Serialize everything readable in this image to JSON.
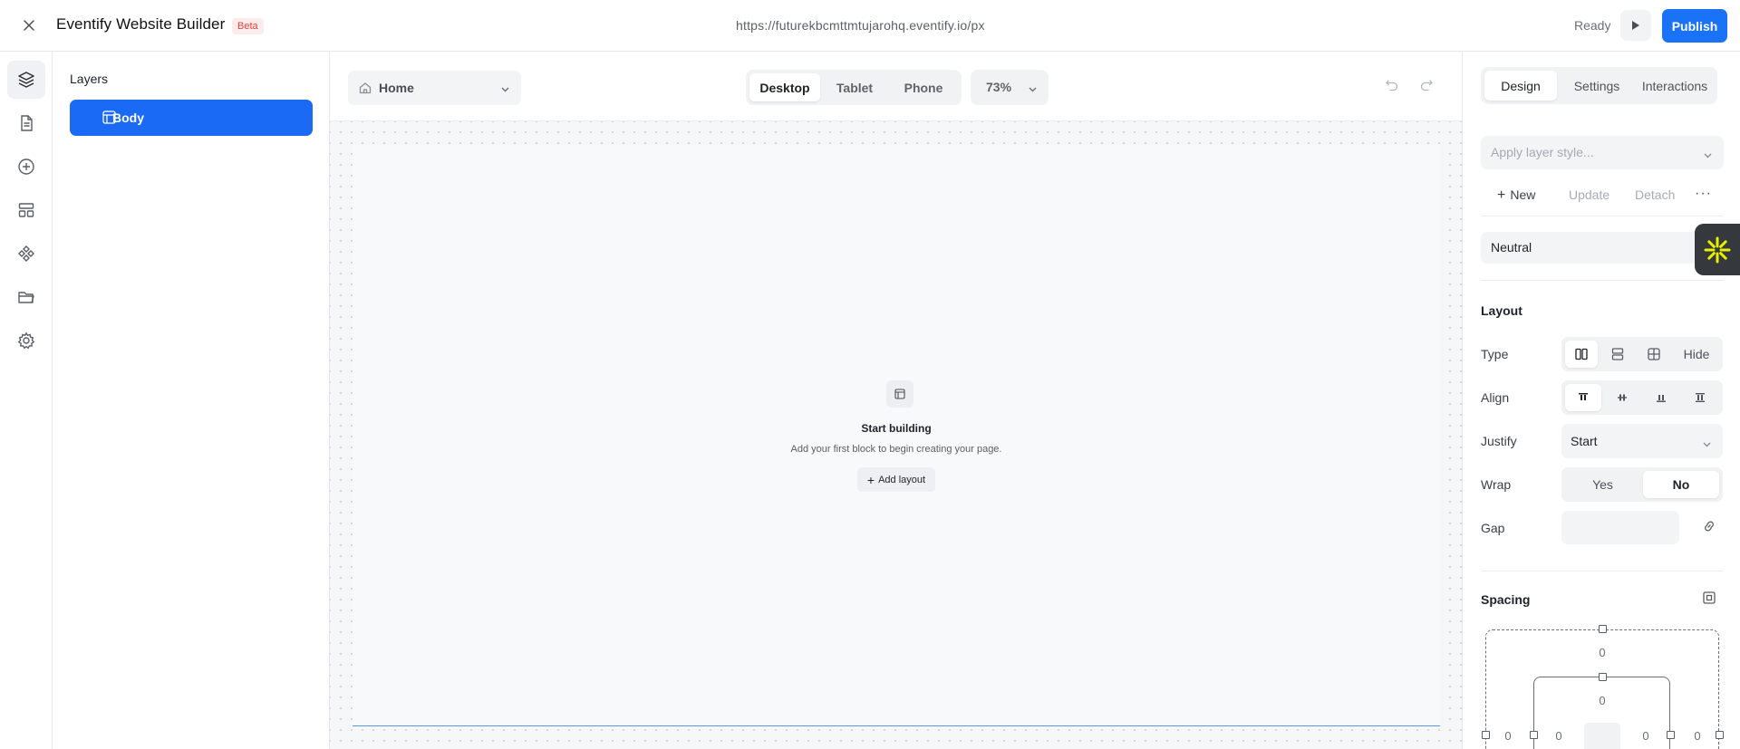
{
  "header": {
    "app_title": "Eventify Website Builder",
    "badge": "Beta",
    "url": "https://futurekbcmttmtujarohq.eventify.io/px",
    "status": "Ready",
    "publish_label": "Publish"
  },
  "rail": {
    "items": [
      {
        "icon": "layers-icon",
        "active": true
      },
      {
        "icon": "page-icon",
        "active": false
      },
      {
        "icon": "add-icon",
        "active": false
      },
      {
        "icon": "layout-icon",
        "active": false
      },
      {
        "icon": "components-icon",
        "active": false
      },
      {
        "icon": "folder-icon",
        "active": false
      },
      {
        "icon": "gear-icon",
        "active": false
      }
    ]
  },
  "layers": {
    "title": "Layers",
    "items": [
      {
        "label": "Body",
        "selected": true
      }
    ]
  },
  "canvas": {
    "page_select": "Home",
    "devices": [
      "Desktop",
      "Tablet",
      "Phone"
    ],
    "active_device": "Desktop",
    "zoom": "73%",
    "empty_state": {
      "title": "Start building",
      "subtitle": "Add your first block to begin creating your page.",
      "button": "Add layout"
    }
  },
  "props": {
    "tabs": [
      "Design",
      "Settings",
      "Interactions"
    ],
    "active_tab": "Design",
    "layer_style_placeholder": "Apply layer style...",
    "style_actions": {
      "new": "New",
      "update": "Update",
      "detach": "Detach",
      "more": "···"
    },
    "neutral": "Neutral",
    "layout": {
      "title": "Layout",
      "type_label": "Type",
      "type_hide": "Hide",
      "align_label": "Align",
      "justify_label": "Justify",
      "justify_value": "Start",
      "wrap_label": "Wrap",
      "wrap_yes": "Yes",
      "wrap_no": "No",
      "wrap_selected": "No",
      "gap_label": "Gap",
      "gap_value": ""
    },
    "spacing": {
      "title": "Spacing",
      "margin_top": "0",
      "padding_top": "0",
      "margin_left": "0",
      "padding_left": "0",
      "padding_right": "0",
      "margin_right": "0"
    }
  },
  "colors": {
    "accent": "#1a73f6",
    "selected_layer": "#1a6af5",
    "beta_text": "#e0463c",
    "beta_bg": "#fdecec",
    "assistant_bg": "#35383d",
    "assistant_icon": "#e8f000"
  }
}
